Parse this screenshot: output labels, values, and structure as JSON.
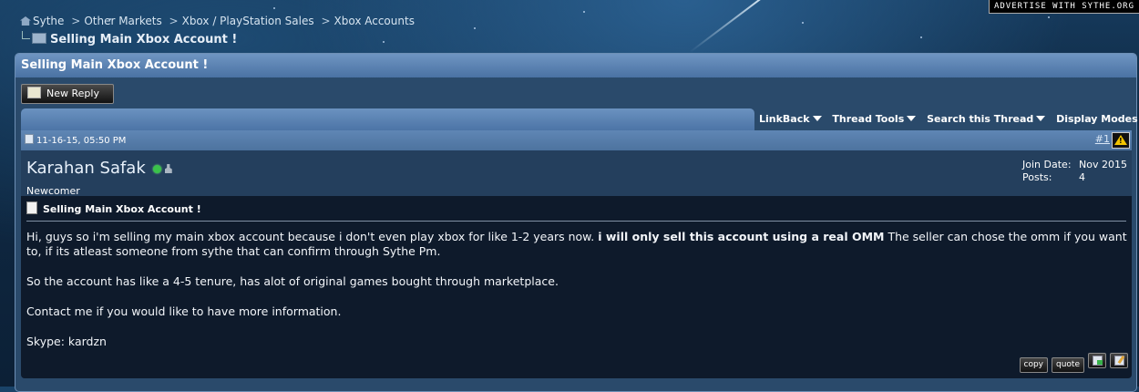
{
  "advert": "ADVERTISE WITH SYTHE.ORG",
  "breadcrumb": {
    "items": [
      "Sythe",
      "Other Markets",
      "Xbox / PlayStation Sales",
      "Xbox Accounts"
    ],
    "separator": ">",
    "current": "Selling Main Xbox Account !"
  },
  "thread": {
    "title": "Selling Main Xbox Account !",
    "new_reply_label": "New Reply",
    "menus": [
      "LinkBack",
      "Thread Tools",
      "Search this Thread",
      "Display Modes"
    ]
  },
  "post": {
    "date": "11-16-15, 05:50 PM",
    "number": "#1",
    "username": "Karahan Safak",
    "user_title": "Newcomer",
    "join_date_label": "Join Date:",
    "join_date": "Nov 2015",
    "posts_label": "Posts:",
    "posts": "4",
    "title": "Selling Main Xbox Account !",
    "body": {
      "p1_start": "Hi, guys so i'm selling my main xbox account because i don't even play xbox for like 1-2 years now. ",
      "p1_bold": "i will only sell this account using a real OMM",
      "p1_end": " The seller can chose the omm if you want to, if its atleast someone from sythe that can confirm through Sythe Pm.",
      "p2": "So the account has like a 4-5 tenure, has alot of original games bought through marketplace.",
      "p3": "Contact me if you would like to have more information.",
      "p4": "Skype: kardzn"
    },
    "actions": {
      "copy": "copy",
      "quote": "quote"
    }
  },
  "icons": [
    "home-icon",
    "folder-icon",
    "pencil-icon",
    "dropdown-arrow-icon",
    "post-icon",
    "warning-icon",
    "online-status-icon",
    "user-icon",
    "document-icon",
    "multiquote-icon",
    "edit-icon"
  ],
  "colors": {
    "panel_header": "#4a72a3",
    "post_body_bg": "#0e1a2b",
    "online": "#3ac24a",
    "warning": "#f3c400"
  }
}
